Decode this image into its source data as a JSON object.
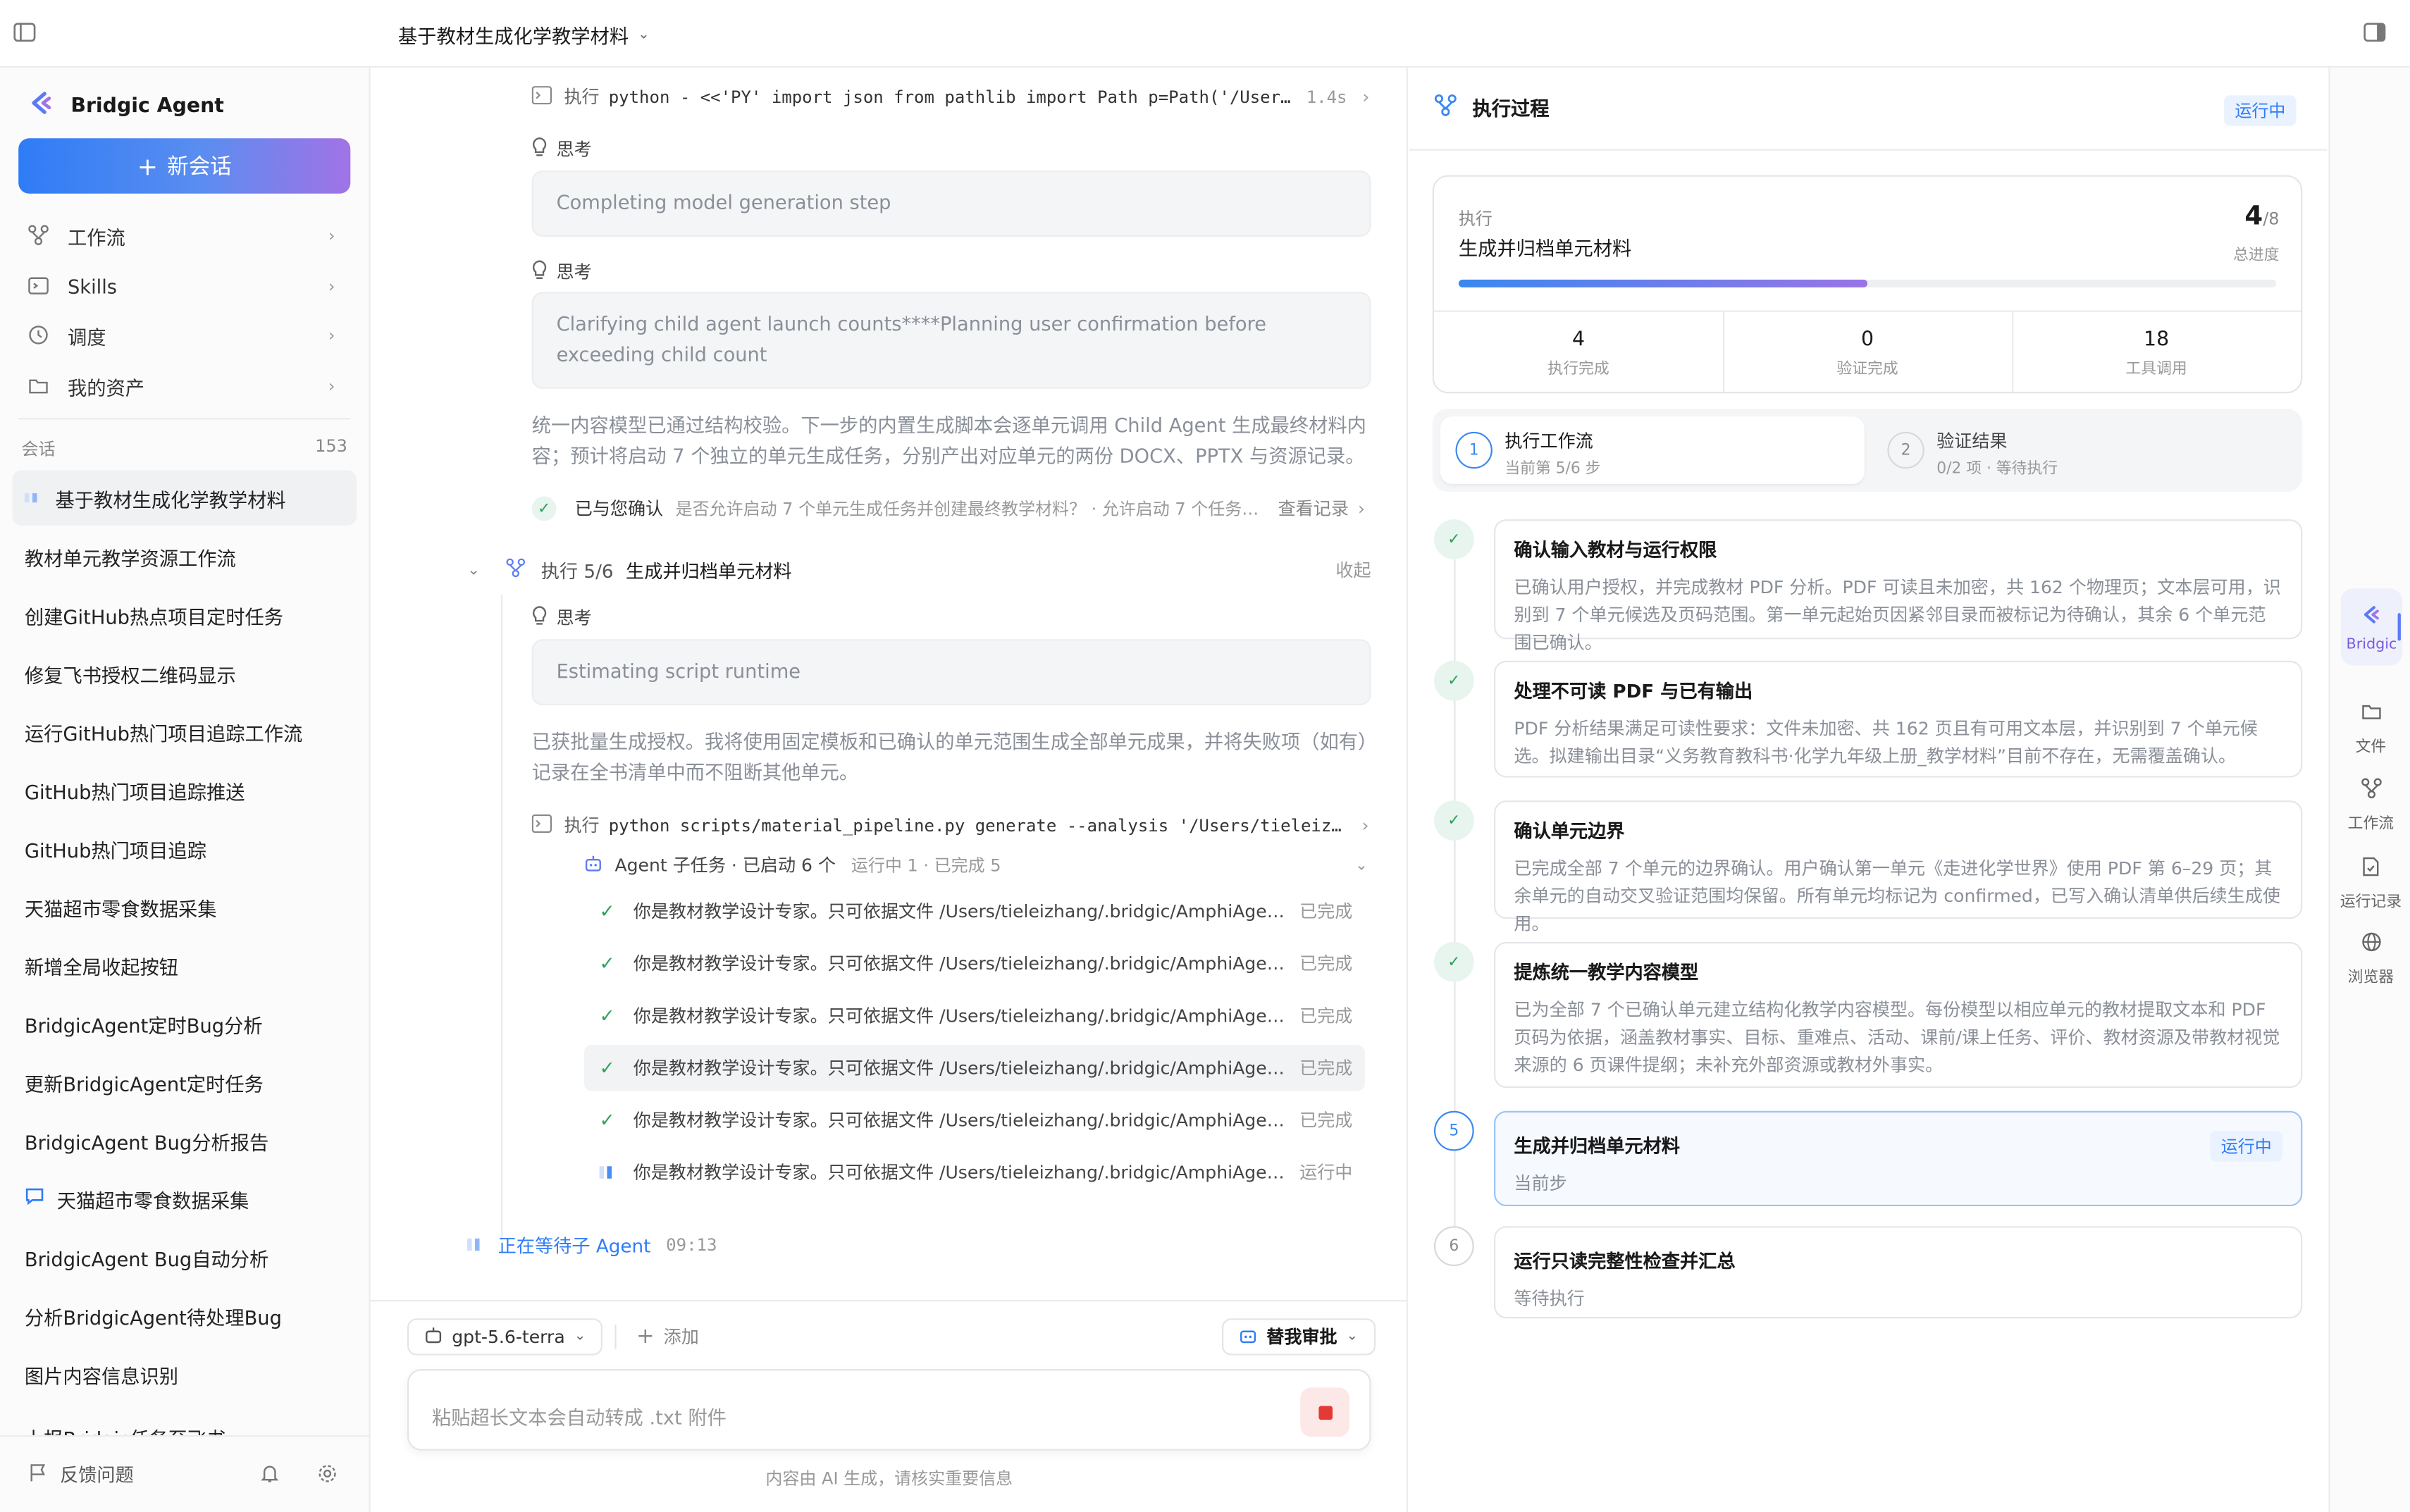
{
  "topbar": {
    "title": "基于教材生成化学教学材料"
  },
  "sidebar": {
    "brand": "Bridgic Agent",
    "new_chat": "新会话",
    "nav": [
      {
        "label": "工作流",
        "icon": "workflow-icon"
      },
      {
        "label": "Skills",
        "icon": "terminal-icon"
      },
      {
        "label": "调度",
        "icon": "clock-icon"
      },
      {
        "label": "我的资产",
        "icon": "folder-icon"
      }
    ],
    "section_label": "会话",
    "section_count": "153",
    "sessions": [
      "基于教材生成化学教学材料",
      "教材单元教学资源工作流",
      "创建GitHub热点项目定时任务",
      "修复飞书授权二维码显示",
      "运行GitHub热门项目追踪工作流",
      "GitHub热门项目追踪推送",
      "GitHub热门项目追踪",
      "天猫超市零食数据采集",
      "新增全局收起按钮",
      "BridgicAgent定时Bug分析",
      "更新BridgicAgent定时任务",
      "BridgicAgent Bug分析报告",
      "天猫超市零食数据采集",
      "BridgicAgent Bug自动分析",
      "分析BridgicAgent待处理Bug",
      "图片内容信息识别",
      "上报Bridgic任务至飞书"
    ],
    "footer_feedback": "反馈问题"
  },
  "middle": {
    "cmd1": {
      "prefix": "执行",
      "cmd": "python - <<'PY' import json from pathlib import Path p=Path('/User…",
      "time": "1.4s"
    },
    "think_label": "思考",
    "think1": "Completing model generation step",
    "think2": "Clarifying child agent launch counts****Planning user confirmation before exceeding child count",
    "para1": "统一内容模型已通过结构校验。下一步的内置生成脚本会逐单元调用 Child Agent 生成最终材料内容；预计将启动 7 个独立的单元生成任务，分别产出对应单元的两份 DOCX、PPTX 与资源记录。",
    "confirm": {
      "label": "已与您确认",
      "question": "是否允许启动 7 个单元生成任务并创建最终教学材料？ · 允许启动 7 个任务并…",
      "link": "查看记录"
    },
    "exec_step": {
      "prefix": "执行 5/6",
      "title": "生成并归档单元材料",
      "collapse": "收起"
    },
    "think3": "Estimating script runtime",
    "para2": "已获批量生成授权。我将使用固定模板和已确认的单元范围生成全部单元成果，并将失败项（如有）记录在全书清单中而不阻断其他单元。",
    "cmd2": {
      "prefix": "执行",
      "cmd": "python scripts/material_pipeline.py generate --analysis '/Users/tieleiz…"
    },
    "subtasks": {
      "title": "Agent 子任务 · 已启动 6 个",
      "status": "运行中 1 · 已完成 5",
      "items": [
        {
          "text": "你是教材教学设计专家。只可依据文件 /Users/tieleizhang/.bridgic/AmphiAgent/s…",
          "status": "已完成"
        },
        {
          "text": "你是教材教学设计专家。只可依据文件 /Users/tieleizhang/.bridgic/AmphiAgent/s…",
          "status": "已完成"
        },
        {
          "text": "你是教材教学设计专家。只可依据文件 /Users/tieleizhang/.bridgic/AmphiAgent/s…",
          "status": "已完成"
        },
        {
          "text": "你是教材教学设计专家。只可依据文件 /Users/tieleizhang/.bridgic/AmphiAgent/s…",
          "status": "已完成"
        },
        {
          "text": "你是教材教学设计专家。只可依据文件 /Users/tieleizhang/.bridgic/AmphiAgent/s…",
          "status": "已完成"
        },
        {
          "text": "你是教材教学设计专家。只可依据文件 /Users/tieleizhang/.bridgic/AmphiAgent/s…",
          "status": "运行中"
        }
      ]
    },
    "waiting": {
      "label": "正在等待子 Agent",
      "time": "09:13"
    },
    "composer": {
      "model": "gpt-5.6-terra",
      "add": "添加",
      "approval": "替我审批",
      "placeholder": "粘贴超长文本会自动转成 .txt 附件",
      "disclaimer": "内容由 AI 生成，请核实重要信息"
    }
  },
  "right": {
    "title": "执行过程",
    "status": "运行中",
    "card": {
      "label": "执行",
      "title": "生成并归档单元材料",
      "progress_num": "4",
      "progress_den": "/8",
      "progress_label": "总进度",
      "progress": 0.5
    },
    "stats": [
      {
        "value": "4",
        "label": "执行完成"
      },
      {
        "value": "0",
        "label": "验证完成"
      },
      {
        "value": "18",
        "label": "工具调用"
      }
    ],
    "tabs": [
      {
        "num": "1",
        "title": "执行工作流",
        "sub": "当前第 5/6 步"
      },
      {
        "num": "2",
        "title": "验证结果",
        "sub": "0/2 项 · 等待执行"
      }
    ],
    "steps": [
      {
        "num": "✓",
        "title": "确认输入教材与运行权限",
        "desc": "已确认用户授权，并完成教材 PDF 分析。PDF 可读且未加密，共 162 个物理页；文本层可用，识别到 7 个单元候选及页码范围。第一单元起始页因紧邻目录而被标记为待确认，其余 6 个单元范围已确认。"
      },
      {
        "num": "✓",
        "title": "处理不可读 PDF 与已有输出",
        "desc": "PDF 分析结果满足可读性要求：文件未加密、共 162 页且有可用文本层，并识别到 7 个单元候选。拟建输出目录“义务教育教科书·化学九年级上册_教学材料”目前不存在，无需覆盖确认。"
      },
      {
        "num": "✓",
        "title": "确认单元边界",
        "desc": "已完成全部 7 个单元的边界确认。用户确认第一单元《走进化学世界》使用 PDF 第 6–29 页；其余单元的自动交叉验证范围均保留。所有单元均标记为 confirmed，已写入确认清单供后续生成使用。"
      },
      {
        "num": "✓",
        "title": "提炼统一教学内容模型",
        "desc": "已为全部 7 个已确认单元建立结构化教学内容模型。每份模型以相应单元的教材提取文本和 PDF 页码为依据，涵盖教材事实、目标、重难点、活动、课前/课上任务、评价、教材资源及带教材视觉来源的 6 页课件提纲；未补充外部资源或教材外事实。"
      },
      {
        "num": "5",
        "title": "生成并归档单元材料",
        "desc": "当前步",
        "badge": "运行中"
      },
      {
        "num": "6",
        "title": "运行只读完整性检查并汇总",
        "desc": "等待执行"
      }
    ]
  },
  "rail": [
    {
      "label": "Bridgic",
      "icon": "bridgic-logo-icon"
    },
    {
      "label": "文件",
      "icon": "folder-icon"
    },
    {
      "label": "工作流",
      "icon": "workflow-icon"
    },
    {
      "label": "运行记录",
      "icon": "record-icon"
    },
    {
      "label": "浏览器",
      "icon": "globe-icon"
    }
  ],
  "colors": {
    "accent": "#2f7cf6",
    "success": "#2aa35a",
    "muted": "#8a8f98",
    "gradient_end": "#a173e6"
  }
}
